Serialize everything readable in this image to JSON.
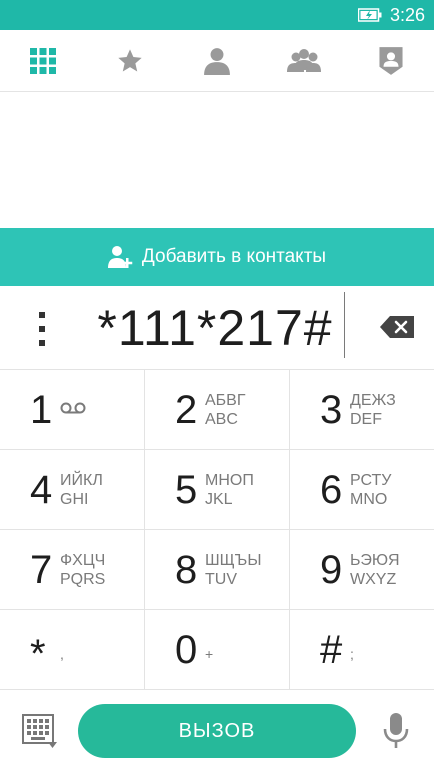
{
  "status_bar": {
    "time": "3:26",
    "battery_icon": "battery-charging-icon"
  },
  "tabs": [
    {
      "name": "dialpad",
      "icon": "dialpad-grid-icon",
      "active": true
    },
    {
      "name": "favorites",
      "icon": "star-icon",
      "active": false
    },
    {
      "name": "contacts",
      "icon": "person-icon",
      "active": false
    },
    {
      "name": "groups",
      "icon": "group-icon",
      "active": false
    },
    {
      "name": "profile",
      "icon": "badge-icon",
      "active": false
    }
  ],
  "add_contact": {
    "label": "Добавить в контакты",
    "icon": "add-person-icon"
  },
  "number": {
    "value": "*111*217#"
  },
  "keys": [
    {
      "digit": "1",
      "letters1": "",
      "letters2": "",
      "extra": "voicemail-icon"
    },
    {
      "digit": "2",
      "letters1": "АБВГ",
      "letters2": "ABC"
    },
    {
      "digit": "3",
      "letters1": "ДЕЖЗ",
      "letters2": "DEF"
    },
    {
      "digit": "4",
      "letters1": "ИЙКЛ",
      "letters2": "GHI"
    },
    {
      "digit": "5",
      "letters1": "МНОП",
      "letters2": "JKL"
    },
    {
      "digit": "6",
      "letters1": "РСТУ",
      "letters2": "MNO"
    },
    {
      "digit": "7",
      "letters1": "ФХЦЧ",
      "letters2": "PQRS"
    },
    {
      "digit": "8",
      "letters1": "ШЩЪЫ",
      "letters2": "TUV"
    },
    {
      "digit": "9",
      "letters1": "ЬЭЮЯ",
      "letters2": "WXYZ"
    },
    {
      "digit": "*",
      "sub": ","
    },
    {
      "digit": "0",
      "sub": "+"
    },
    {
      "digit": "#",
      "sub": ";"
    }
  ],
  "bottom": {
    "call_label": "ВЫЗОВ"
  },
  "colors": {
    "accent": "#1fb8a8",
    "call_green": "#26b99a",
    "tab_active": "#1fb8a8",
    "tab_inactive": "#9a9a9a"
  }
}
